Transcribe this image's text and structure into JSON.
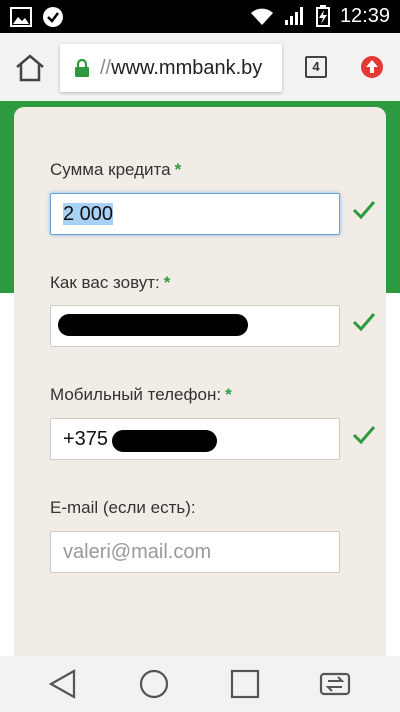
{
  "status_bar": {
    "time": "12:39"
  },
  "browser": {
    "url_scheme": "//",
    "url_host": "www.mmbank.by",
    "tab_count": "4"
  },
  "form": {
    "loan_amount": {
      "label": "Сумма кредита",
      "required_mark": "*",
      "value": "2 000"
    },
    "name": {
      "label": "Как вас зовут:",
      "required_mark": "*"
    },
    "phone": {
      "label": "Мобильный телефон:",
      "required_mark": "*",
      "value": "+375"
    },
    "email": {
      "label": "E-mail (если есть):",
      "placeholder": "valeri@mail.com"
    }
  },
  "colors": {
    "accent_green": "#2e9a3f",
    "card_bg": "#f1ede6",
    "update_red": "#e53935"
  }
}
